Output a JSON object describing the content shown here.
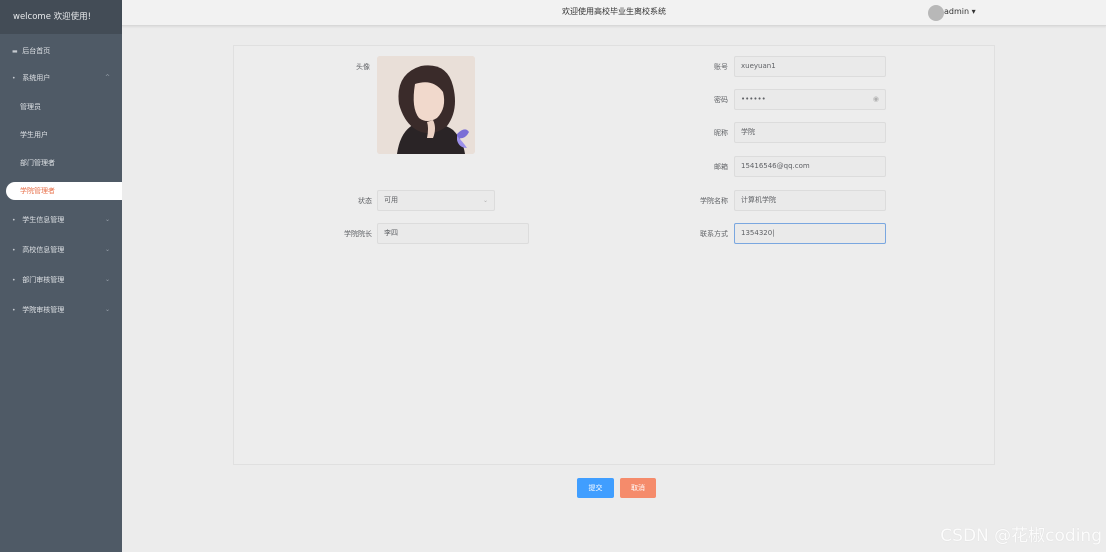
{
  "sidebar": {
    "welcome": "welcome 欢迎使用!",
    "home": "后台首页",
    "groups": [
      {
        "label": "系统用户",
        "chevron": "^"
      },
      {
        "label": "学生信息管理",
        "chevron": "⌄"
      },
      {
        "label": "高校信息管理",
        "chevron": "⌄"
      },
      {
        "label": "部门审核管理",
        "chevron": "⌄"
      },
      {
        "label": "学院审核管理",
        "chevron": "⌄"
      }
    ],
    "sub_items": [
      "管理员",
      "学生用户",
      "部门管理者",
      "学院管理者"
    ]
  },
  "header": {
    "title": "欢迎使用高校毕业生离校系统",
    "user": "admin ▾"
  },
  "form": {
    "avatar_label": "头像",
    "account_label": "账号",
    "account_value": "xueyuan1",
    "password_label": "密码",
    "password_value": "••••••",
    "nickname_label": "昵称",
    "nickname_value": "学院",
    "email_label": "邮箱",
    "email_value": "15416546@qq.com",
    "status_label": "状态",
    "status_value": "可用",
    "college_label": "学院名称",
    "college_value": "计算机学院",
    "dean_label": "学院院长",
    "dean_value": "李四",
    "contact_label": "联系方式",
    "contact_value": "1354320|"
  },
  "actions": {
    "submit": "提交",
    "cancel": "取消"
  },
  "watermark": "CSDN @花椒coding",
  "colors": {
    "sidebar_bg": "#4f5a66",
    "accent": "#409eff",
    "cancel": "#f58b6b",
    "active_text": "#e8704a"
  }
}
